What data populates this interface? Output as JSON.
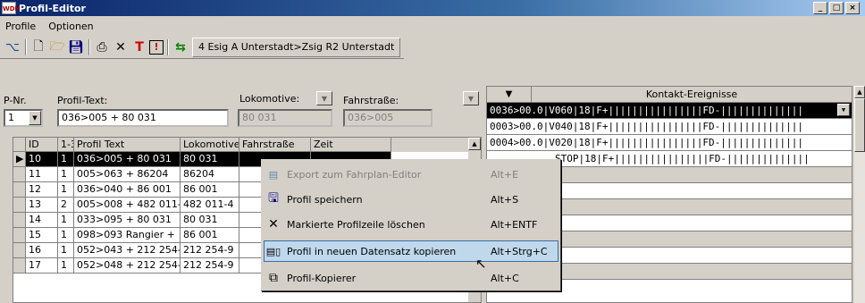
{
  "window": {
    "title": "Profil-Editor",
    "app_icon": "WDM"
  },
  "menu": [
    "Profile",
    "Optionen"
  ],
  "toolbar": {
    "route_label": "4 Esig A Unterstadt>Zsig R2 Unterstadt"
  },
  "header": {
    "pnr_label": "P-Nr.",
    "pnr_value": "1",
    "profiltext_label": "Profil-Text:",
    "profiltext_value": "036>005 + 80 031",
    "lok_label": "Lokomotive:",
    "lok_value": "80 031",
    "fahr_label": "Fahrstraße:",
    "fahr_value": "036>005"
  },
  "grid": {
    "columns": [
      "ID",
      "1-3",
      "Profil Text",
      "Lokomotive",
      "Fahrstraße",
      "Zeit"
    ],
    "rows": [
      {
        "id": "10",
        "n": "1",
        "text": "036>005 + 80 031",
        "lok": "80 031",
        "fahr": "",
        "zeit": ""
      },
      {
        "id": "11",
        "n": "1",
        "text": "005>063 + 86204",
        "lok": "86204",
        "fahr": "",
        "zeit": ""
      },
      {
        "id": "12",
        "n": "1",
        "text": "036>040 + 86 001",
        "lok": "86 001",
        "fahr": "",
        "zeit": ""
      },
      {
        "id": "13",
        "n": "2",
        "text": "005>008 + 482 011-",
        "lok": "482 011-4",
        "fahr": "",
        "zeit": ""
      },
      {
        "id": "14",
        "n": "1",
        "text": "033>095 + 80 031",
        "lok": "80 031",
        "fahr": "",
        "zeit": ""
      },
      {
        "id": "15",
        "n": "1",
        "text": "098>093 Rangier +",
        "lok": "86 001",
        "fahr": "",
        "zeit": ""
      },
      {
        "id": "16",
        "n": "1",
        "text": "052>043 + 212 254-",
        "lok": "212 254-9",
        "fahr": "",
        "zeit": ""
      },
      {
        "id": "17",
        "n": "1",
        "text": "052>048 + 212 254-",
        "lok": "212 254-9",
        "fahr": "",
        "zeit": ""
      }
    ]
  },
  "kontakt": {
    "title": "Kontakt-Ereignisse",
    "rows": [
      "0036>00.0|V060|18|F+||||||||||||||||FD-||||||||||||||",
      "0003>00.0|V040|18|F+||||||||||||||||FD-||||||||||||||",
      "0004>00.0|V020|18|F+||||||||||||||||FD-||||||||||||||",
      "STOP|18|F+||||||||||||||||FD-||||||||||||||"
    ]
  },
  "context_menu": {
    "items": [
      {
        "label": "Export zum Fahrplan-Editor",
        "shortcut": "Alt+E",
        "icon": "export-icon",
        "disabled": true
      },
      {
        "label": "Profil speichern",
        "shortcut": "Alt+S",
        "icon": "save-icon",
        "disabled": false
      },
      {
        "label": "Markierte Profilzeile löschen",
        "shortcut": "Alt+ENTF",
        "icon": "delete-x-icon",
        "disabled": false
      },
      {
        "label": "Profil in neuen Datensatz kopieren",
        "shortcut": "Alt+Strg+C",
        "icon": "copy-record-icon",
        "disabled": false
      },
      {
        "label": "Profil-Kopierer",
        "shortcut": "Alt+C",
        "icon": "copier-icon",
        "disabled": false
      }
    ]
  }
}
